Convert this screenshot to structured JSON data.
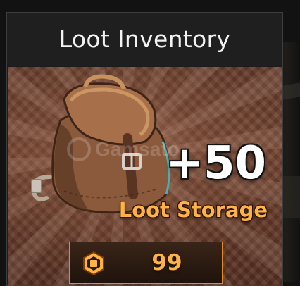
{
  "window": {
    "title": "Loot Inventory"
  },
  "item": {
    "bonus_text": "+50",
    "label": "Loot Storage",
    "icon": "backpack-icon",
    "watermark_text": "Gamsato"
  },
  "purchase": {
    "price": "99",
    "currency_icon": "robux-icon"
  },
  "colors": {
    "accent": "#ffb347",
    "button_border": "#e5892a",
    "card_brown": "#7a4a36"
  }
}
